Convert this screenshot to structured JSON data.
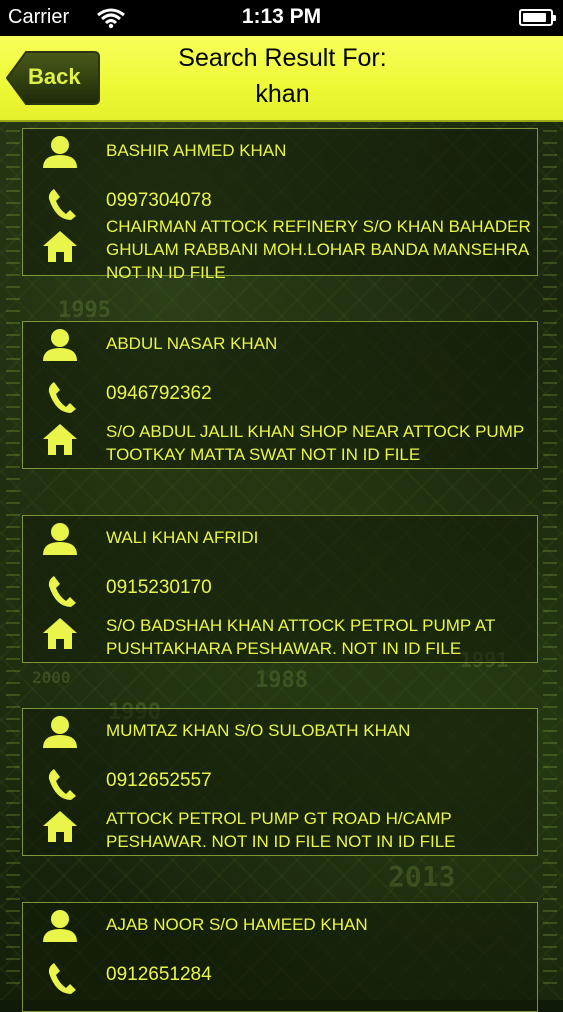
{
  "status_bar": {
    "carrier": "Carrier",
    "time": "1:13 PM",
    "battery_level": 0.9
  },
  "header": {
    "back_label": "Back",
    "title": "Search Result For:",
    "query": "khan",
    "background_color": "#eef936"
  },
  "background_years": [
    "1995",
    "2000",
    "1988",
    "1990",
    "1991",
    "2013"
  ],
  "results": [
    {
      "name": "BASHIR AHMED KHAN",
      "phone": "0997304078",
      "address": "CHAIRMAN ATTOCK REFINERY S/O KHAN BAHADER GHULAM RABBANI MOH.LOHAR BANDA MANSEHRA NOT IN ID FILE"
    },
    {
      "name": "ABDUL NASAR KHAN",
      "phone": "0946792362",
      "address": "S/O ABDUL JALIL KHAN SHOP NEAR ATTOCK PUMP TOOTKAY MATTA SWAT NOT IN ID FILE"
    },
    {
      "name": "WALI KHAN AFRIDI",
      "phone": "0915230170",
      "address": "S/O BADSHAH KHAN ATTOCK PETROL PUMP AT PUSHTAKHARA PESHAWAR. NOT IN ID FILE"
    },
    {
      "name": "MUMTAZ KHAN S/O SULOBATH KHAN",
      "phone": "0912652557",
      "address": "ATTOCK PETROL PUMP GT ROAD H/CAMP PESHAWAR. NOT IN ID FILE NOT IN ID FILE"
    },
    {
      "name": "AJAB NOOR S/O HAMEED KHAN",
      "phone": "0912651284",
      "address": ""
    }
  ],
  "icons": {
    "person": "person-icon",
    "phone": "phone-icon",
    "address": "home-icon"
  },
  "colors": {
    "accent": "#e9f54a",
    "header": "#eef936",
    "card_border": "#a0be46"
  }
}
